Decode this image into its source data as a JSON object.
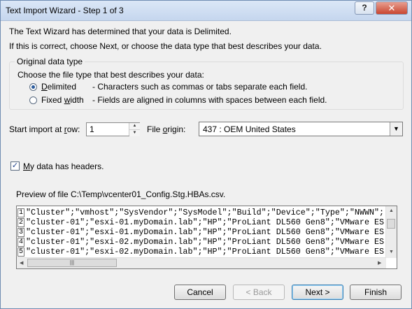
{
  "window": {
    "title": "Text Import Wizard - Step 1 of 3",
    "help_label": "?",
    "close_label": "✕"
  },
  "intro": {
    "line1": "The Text Wizard has determined that your data is Delimited.",
    "line2": "If this is correct, choose Next, or choose the data type that best describes your data."
  },
  "original_data_type": {
    "legend": "Original data type",
    "prompt": "Choose the file type that best describes your data:",
    "options": [
      {
        "key": "D",
        "rest": "elimited",
        "description": "- Characters such as commas or tabs separate each field.",
        "selected": true
      },
      {
        "before": "Fixed ",
        "key": "w",
        "rest": "idth",
        "description": "- Fields are aligned in columns with spaces between each field.",
        "selected": false
      }
    ]
  },
  "start_import": {
    "label_before": "Start import at ",
    "label_key": "r",
    "label_after": "ow:",
    "value": "1"
  },
  "file_origin": {
    "label_before": "File ",
    "label_key": "o",
    "label_after": "rigin:",
    "value": "437 : OEM United States"
  },
  "headers_checkbox": {
    "key": "M",
    "rest": "y data has headers.",
    "checked": true
  },
  "preview": {
    "label": "Preview of file C:\\Temp\\vcenter01_Config.Stg.HBAs.csv.",
    "rows": [
      {
        "num": "1",
        "text": "\"Cluster\";\"vmhost\";\"SysVendor\";\"SysModel\";\"Build\";\"Device\";\"Type\";\"NWWN\";"
      },
      {
        "num": "2",
        "text": "\"cluster-01\";\"esxi-01.myDomain.lab\";\"HP\";\"ProLiant DL560 Gen8\";\"VMware ES"
      },
      {
        "num": "3",
        "text": "\"cluster-01\";\"esxi-01.myDomain.lab\";\"HP\";\"ProLiant DL560 Gen8\";\"VMware ES"
      },
      {
        "num": "4",
        "text": "\"cluster-01\";\"esxi-02.myDomain.lab\";\"HP\";\"ProLiant DL560 Gen8\";\"VMware ES"
      },
      {
        "num": "5",
        "text": "\"cluster-01\";\"esxi-02.myDomain.lab\";\"HP\";\"ProLiant DL560 Gen8\";\"VMware ES"
      }
    ]
  },
  "buttons": {
    "cancel": "Cancel",
    "back": "< Back",
    "next": "Next >",
    "finish": "Finish"
  }
}
